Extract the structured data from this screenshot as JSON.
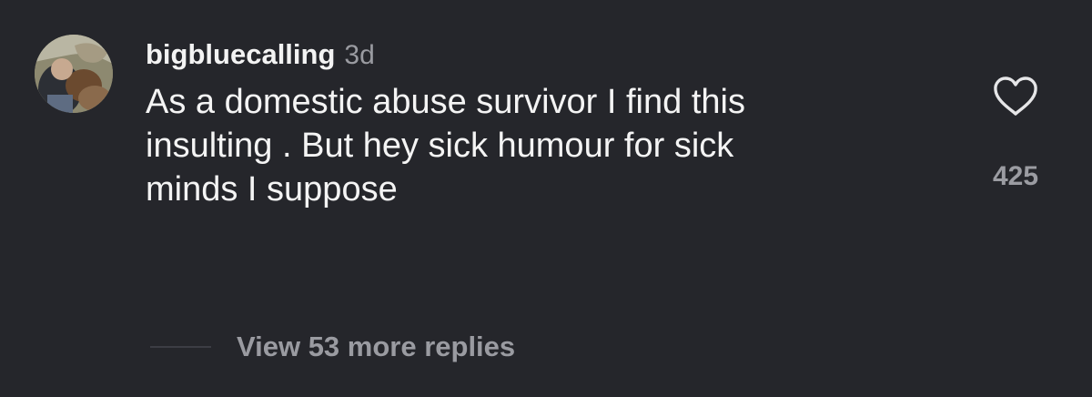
{
  "comment": {
    "username": "bigbluecalling",
    "time": "3d",
    "text_lines": [
      "As a domestic abuse survivor I find this",
      "insulting . But hey sick humour for sick",
      "minds I suppose"
    ],
    "like_count": "425",
    "replies_label": "View 53 more replies",
    "icons": {
      "like": "heart-icon"
    }
  },
  "colors": {
    "background": "#25262b",
    "primary_text": "#f4f4f4",
    "secondary_text": "#9a9ba1"
  }
}
